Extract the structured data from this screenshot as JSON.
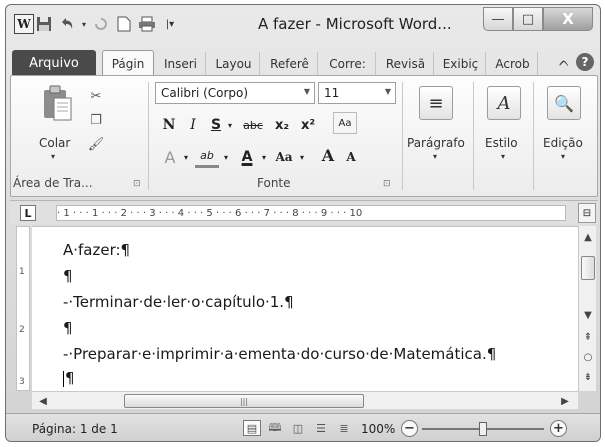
{
  "window": {
    "title": "A fazer - Microsoft Word...",
    "app_icon": "W",
    "minimize": "—",
    "maximize": "□",
    "close": "X"
  },
  "quick_access": {
    "save_icon": "save-icon",
    "undo_icon": "undo-icon",
    "redo_icon": "redo-icon",
    "new_icon": "new-document-icon",
    "print_icon": "print-icon",
    "customize_icon": "dropdown-icon"
  },
  "tabs": {
    "file": "Arquivo",
    "items": [
      "Págin",
      "Inseri",
      "Layou",
      "Referê",
      "Corre:",
      "Revisã",
      "Exibiç",
      "Acrob"
    ]
  },
  "ribbon": {
    "clipboard": {
      "paste_label": "Colar",
      "group_label": "Área de Tra..."
    },
    "font": {
      "font_name": "Calibri (Corpo)",
      "font_size": "11",
      "bold": "N",
      "italic": "I",
      "underline": "S",
      "strike": "abc",
      "subscript": "x₂",
      "superscript": "x²",
      "grow": "A",
      "shrink": "A",
      "change_case": "Aa",
      "font_color": "A",
      "highlight": "ab",
      "group_label": "Fonte"
    },
    "paragraph": {
      "label": "Parágrafo"
    },
    "styles": {
      "label": "Estilo"
    },
    "editing": {
      "label": "Edição"
    }
  },
  "ruler": {
    "marks": "· 1 · · · 1 · · · 2 · · · 3 · · · 4 · · · 5 · · · 6 · · · 7 · · · 8 · · · 9 · · · 10",
    "tab_selector": "L"
  },
  "document": {
    "lines": [
      "A·fazer:¶",
      "¶",
      "-·Terminar·de·ler·o·capítulo·1.¶",
      "¶",
      "-·Preparar·e·imprimir·a·ementa·do·curso·de·Matemática.¶",
      "¶"
    ],
    "vruler_marks": [
      "1",
      "2",
      "3"
    ]
  },
  "status": {
    "page": "Página: 1 de 1",
    "zoom": "100%",
    "zoom_level": 0.5
  }
}
